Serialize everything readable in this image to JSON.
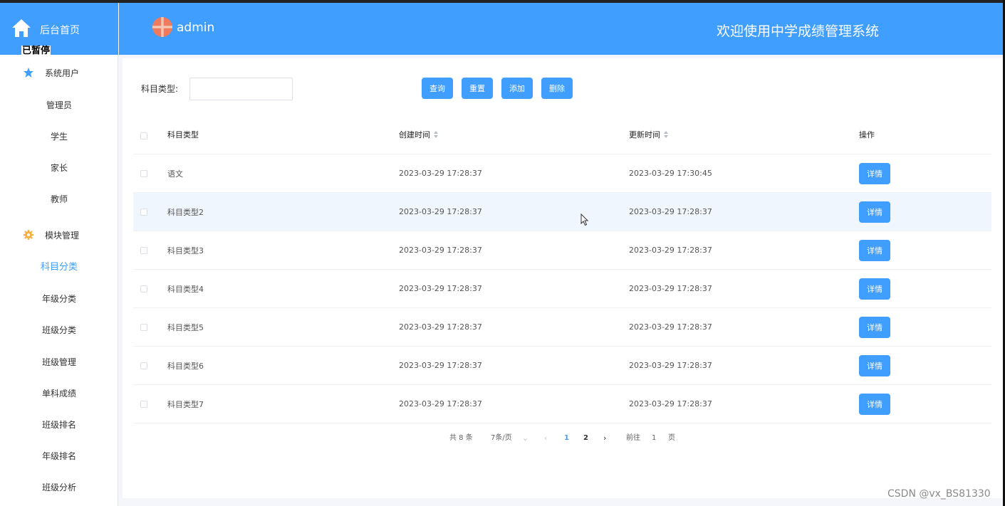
{
  "sidebar": {
    "brand_label": "后台首页",
    "paused_label": "已暂停",
    "groups": [
      {
        "label": "系统用户",
        "icon": "star-icon",
        "items": [
          "管理员",
          "学生",
          "家长",
          "教师"
        ]
      },
      {
        "label": "模块管理",
        "icon": "gear-icon",
        "items": [
          "科目分类",
          "年级分类",
          "班级分类",
          "班级管理",
          "单科成绩",
          "班级排名",
          "年级排名",
          "班级分析"
        ]
      }
    ],
    "active_item": "科目分类"
  },
  "header": {
    "username": "admin",
    "title": "欢迎使用中学成绩管理系统",
    "accent_color": "#409eff"
  },
  "filter": {
    "label": "科目类型:",
    "value": "",
    "placeholder": ""
  },
  "toolbar": {
    "search_label": "查询",
    "reset_label": "重置",
    "add_label": "添加",
    "delete_label": "删除"
  },
  "table": {
    "columns": {
      "type": "科目类型",
      "created": "创建时间",
      "updated": "更新时间",
      "op": "操作"
    },
    "rows": [
      {
        "type": "语文",
        "created": "2023-03-29 17:28:37",
        "updated": "2023-03-29 17:30:45",
        "action": "详情"
      },
      {
        "type": "科目类型2",
        "created": "2023-03-29 17:28:37",
        "updated": "2023-03-29 17:28:37",
        "action": "详情"
      },
      {
        "type": "科目类型3",
        "created": "2023-03-29 17:28:37",
        "updated": "2023-03-29 17:28:37",
        "action": "详情"
      },
      {
        "type": "科目类型4",
        "created": "2023-03-29 17:28:37",
        "updated": "2023-03-29 17:28:37",
        "action": "详情"
      },
      {
        "type": "科目类型5",
        "created": "2023-03-29 17:28:37",
        "updated": "2023-03-29 17:28:37",
        "action": "详情"
      },
      {
        "type": "科目类型6",
        "created": "2023-03-29 17:28:37",
        "updated": "2023-03-29 17:28:37",
        "action": "详情"
      },
      {
        "type": "科目类型7",
        "created": "2023-03-29 17:28:37",
        "updated": "2023-03-29 17:28:37",
        "action": "详情"
      }
    ]
  },
  "pagination": {
    "total": "共 8 条",
    "page_size": "7条/页",
    "pages": [
      "1",
      "2"
    ],
    "current_page": "1",
    "goto_prefix": "前往",
    "goto_value": "1",
    "goto_suffix": "页"
  },
  "watermark": "CSDN @vx_BS81330"
}
